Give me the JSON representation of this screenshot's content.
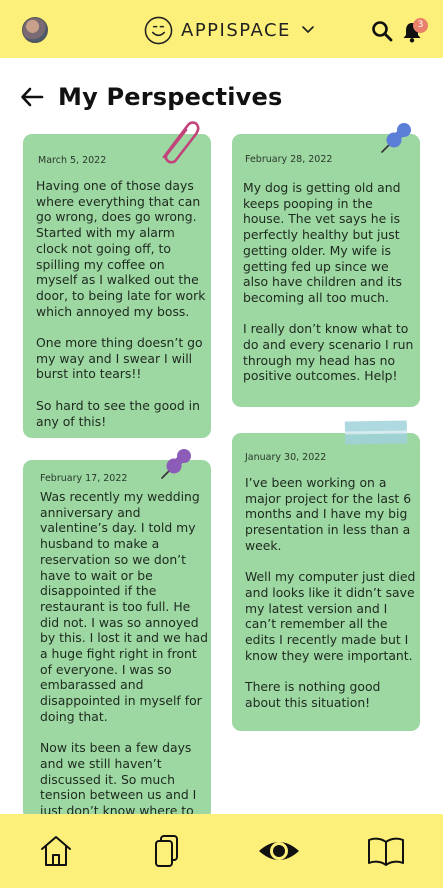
{
  "header": {
    "brand": "APPISPACE",
    "notification_count": "3",
    "avatar": "profile-photo",
    "icons": [
      "smiley-logo-icon",
      "chevron-down-icon",
      "search-icon",
      "bell-icon"
    ]
  },
  "page": {
    "title": "My Perspectives",
    "back_icon": "back-arrow-icon"
  },
  "notes": [
    {
      "date": "March 5, 2022",
      "body": "Having one of those days where everything that can go wrong, does go wrong. Started with my alarm clock not going off, to spilling my coffee on myself as I walked out the door, to being late for work which annoyed my boss.\n\nOne more thing doesn’t go my way and I swear I will burst into tears!!\n\nSo hard to see the good in any of this!",
      "decoration": "paperclip-icon"
    },
    {
      "date": "February 28, 2022",
      "body": "My dog is getting old and keeps pooping in the house.  The vet says he is perfectly healthy but just getting older.  My wife is getting fed up since we also have children and its becoming all too much.\n\nI really don’t know what to do and every scenario I run through my head has no positive outcomes. Help!",
      "decoration": "pushpin-icon"
    },
    {
      "date": "February 17, 2022",
      "body": "Was recently my wedding anniversary and valentine’s day.  I told my husband to make a reservation so we don’t have to wait or be disappointed if the restaurant is too full.  He did not.  I was so annoyed by this. I lost it and we had a huge fight right in front of everyone. I was so embarassed and disappointed in myself for doing that.\n\nNow its been a few days and we still haven’t discussed it. So much tension between us and I just don’t know where to",
      "decoration": "pushpin-icon"
    },
    {
      "date": "January 30, 2022",
      "body": "I’ve been working on a major project for the last 6 months and I have my big presentation in less than a week.\n\nWell my computer just died and looks like it didn’t save my latest version and I can’t remember all the edits I recently made but I know they were important.\n\nThere is nothing good about this situation!",
      "decoration": "tape"
    }
  ],
  "bottom_nav": [
    "home-icon",
    "cards-icon",
    "eye-icon",
    "book-icon"
  ],
  "colors": {
    "bar_yellow": "#fdf07a",
    "note_green": "#9dd7a2",
    "pin_blue": "#5b7fd6",
    "pin_purple": "#8d5cb8",
    "clip_pink": "#c2437a",
    "badge": "#e8806a"
  }
}
